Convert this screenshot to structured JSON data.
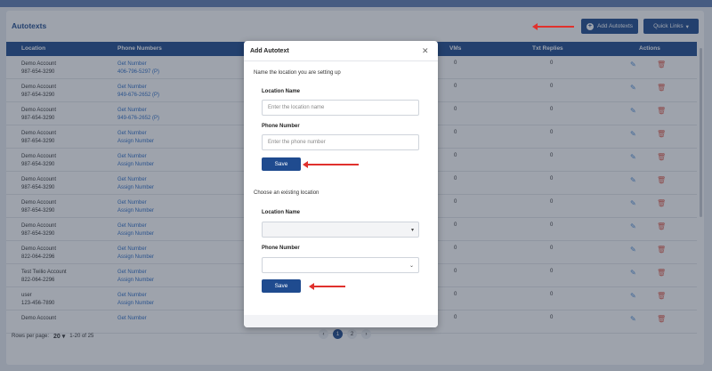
{
  "page": {
    "title": "Autotexts",
    "add_button": "Add Autotexts",
    "quick_links": "Quick Links"
  },
  "table": {
    "headers": {
      "location": "Location",
      "phone": "Phone Numbers",
      "vms": "VMs",
      "txt": "Txt Replies",
      "actions": "Actions"
    },
    "rows": [
      {
        "loc": "Demo Account",
        "sub": "987-654-3290",
        "p1": "Get Number",
        "p2": "406-796-5297 (P)",
        "vms": "0",
        "txt": "0"
      },
      {
        "loc": "Demo Account",
        "sub": "987-654-3290",
        "p1": "Get Number",
        "p2": "949-676-2652 (P)",
        "vms": "0",
        "txt": "0"
      },
      {
        "loc": "Demo Account",
        "sub": "987-654-3290",
        "p1": "Get Number",
        "p2": "949-676-2652 (P)",
        "vms": "0",
        "txt": "0"
      },
      {
        "loc": "Demo Account",
        "sub": "987-654-3290",
        "p1": "Get Number",
        "p2": "Assign Number",
        "vms": "0",
        "txt": "0"
      },
      {
        "loc": "Demo Account",
        "sub": "987-654-3290",
        "p1": "Get Number",
        "p2": "Assign Number",
        "vms": "0",
        "txt": "0"
      },
      {
        "loc": "Demo Account",
        "sub": "987-654-3290",
        "p1": "Get Number",
        "p2": "Assign Number",
        "vms": "0",
        "txt": "0"
      },
      {
        "loc": "Demo Account",
        "sub": "987-654-3290",
        "p1": "Get Number",
        "p2": "Assign Number",
        "vms": "0",
        "txt": "0"
      },
      {
        "loc": "Demo Account",
        "sub": "987-654-3290",
        "p1": "Get Number",
        "p2": "Assign Number",
        "vms": "0",
        "txt": "0"
      },
      {
        "loc": "Demo Account",
        "sub": "822-064-2296",
        "p1": "Get Number",
        "p2": "Assign Number",
        "vms": "0",
        "txt": "0"
      },
      {
        "loc": "Test Twilio Account",
        "sub": "822-064-2296",
        "p1": "Get Number",
        "p2": "Assign Number",
        "vms": "0",
        "txt": "0"
      },
      {
        "loc": "user",
        "sub": "123-456-7890",
        "p1": "Get Number",
        "p2": "Assign Number",
        "vms": "0",
        "txt": "0"
      },
      {
        "loc": "Demo Account",
        "sub": "",
        "p1": "Get Number",
        "p2": "",
        "vms": "0",
        "txt": "0"
      }
    ]
  },
  "footer": {
    "rows_per_page_label": "Rows per page:",
    "rows_per_page_value": "20",
    "range": "1-20 of 25",
    "pages": [
      "1",
      "2"
    ]
  },
  "modal": {
    "title": "Add Autotext",
    "section1": "Name the location you are setting up",
    "location_label": "Location Name",
    "location_placeholder": "Enter the location name",
    "phone_label": "Phone Number",
    "phone_placeholder": "Enter the phone number",
    "save": "Save",
    "section2": "Choose an existing location",
    "location_label2": "Location Name",
    "phone_label2": "Phone Number",
    "save2": "Save"
  },
  "colors": {
    "primary": "#1f4b8f",
    "link": "#2f6fc7",
    "arrow": "#e0312d",
    "danger": "#e05b4b"
  }
}
